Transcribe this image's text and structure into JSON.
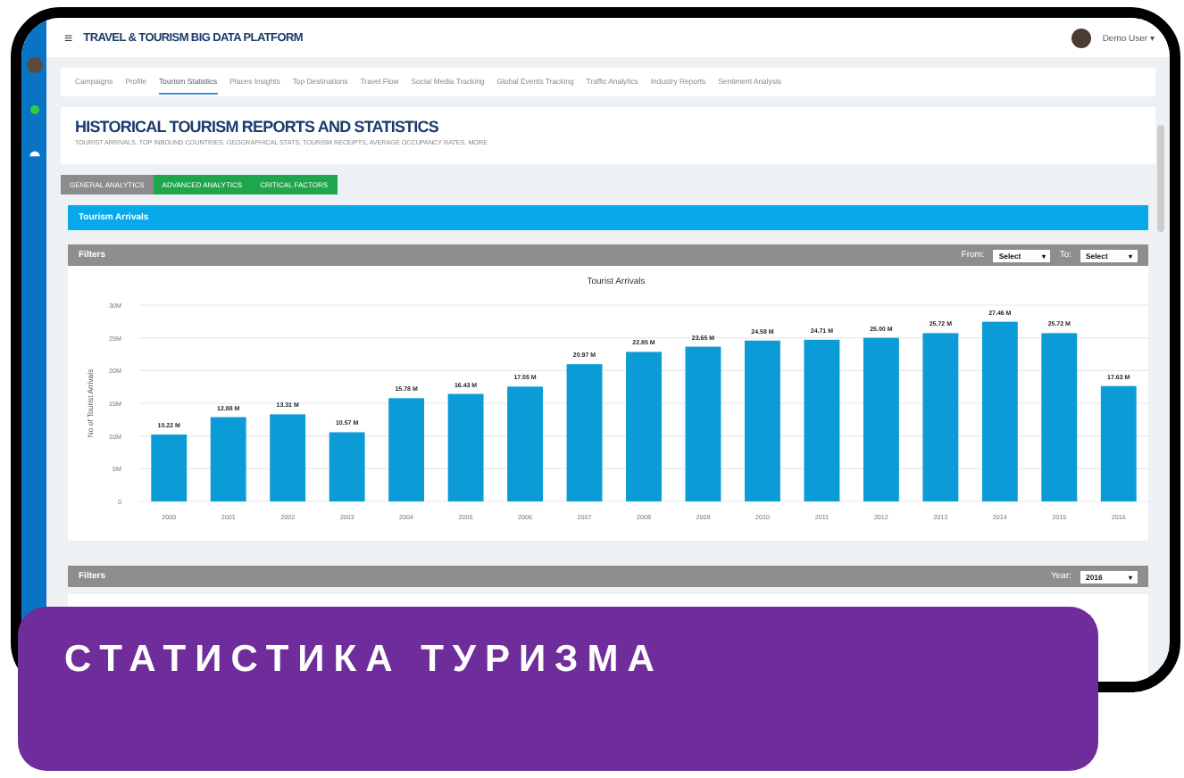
{
  "app": {
    "menu_icon": "≡",
    "title": "TRAVEL & TOURISM BIG DATA PLATFORM",
    "user": "Demo User",
    "user_caret": "▾"
  },
  "nav_tabs": [
    {
      "label": "Campaigns",
      "selected": false
    },
    {
      "label": "Profile",
      "selected": false
    },
    {
      "label": "Tourism Statistics",
      "selected": true
    },
    {
      "label": "Places Insights",
      "selected": false
    },
    {
      "label": "Top Destinations",
      "selected": false
    },
    {
      "label": "Travel Flow",
      "selected": false
    },
    {
      "label": "Social Media Tracking",
      "selected": false
    },
    {
      "label": "Global Events Tracking",
      "selected": false
    },
    {
      "label": "Traffic Analytics",
      "selected": false
    },
    {
      "label": "Industry Reports",
      "selected": false
    },
    {
      "label": "Sentiment Analysis",
      "selected": false
    }
  ],
  "header": {
    "title": "HISTORICAL TOURISM REPORTS AND STATISTICS",
    "subtitle": "TOURIST ARRIVALS, TOP INBOUND COUNTRIES, GEOGRAPHICAL STATS, TOURISM RECEIPTS, AVERAGE OCCUPANCY RATES, MORE"
  },
  "analytics_tabs": [
    {
      "label": "GENERAL ANALYTICS",
      "selected": true
    },
    {
      "label": "ADVANCED ANALYTICS",
      "selected": false
    },
    {
      "label": "CRITICAL FACTORS",
      "selected": false
    }
  ],
  "section_title": "Tourism Arrivals",
  "filters": {
    "label": "Filters",
    "from_label": "From:",
    "from_value": "Select",
    "to_label": "To:",
    "to_value": "Select",
    "caret": "▾"
  },
  "chart_data": {
    "type": "bar",
    "grid": true,
    "title": "Tourist Arrivals",
    "ylabel": "No of Tourist Arrivals",
    "categories": [
      "2000",
      "2001",
      "2002",
      "2003",
      "2004",
      "2005",
      "2006",
      "2007",
      "2008",
      "2009",
      "2010",
      "2011",
      "2012",
      "2013",
      "2014",
      "2015",
      "2016"
    ],
    "values": [
      10.22,
      12.88,
      13.31,
      10.57,
      15.78,
      16.43,
      17.55,
      20.97,
      22.85,
      23.65,
      24.58,
      24.71,
      25.0,
      25.72,
      27.46,
      25.72,
      17.63
    ],
    "value_labels": [
      "10.22 M",
      "12.88 M",
      "13.31 M",
      "10.57 M",
      "15.78 M",
      "16.43 M",
      "17.55 M",
      "20.97 M",
      "22.85 M",
      "23.65 M",
      "24.58 M",
      "24.71 M",
      "25.00 M",
      "25.72 M",
      "27.46 M",
      "25.72 M",
      "17.63 M"
    ],
    "ylim": [
      0,
      30
    ],
    "yticks": [
      {
        "value": 0,
        "label": "0"
      },
      {
        "value": 5,
        "label": "5M"
      },
      {
        "value": 10,
        "label": "10M"
      },
      {
        "value": 15,
        "label": "15M"
      },
      {
        "value": 20,
        "label": "20M"
      },
      {
        "value": 25,
        "label": "25M"
      },
      {
        "value": 30,
        "label": "30M"
      }
    ]
  },
  "filters_2": {
    "label": "Filters",
    "year_label": "Year:",
    "year_value": "2016",
    "caret": "▾"
  },
  "banner": "СТАТИСТИКА ТУРИЗМА"
}
